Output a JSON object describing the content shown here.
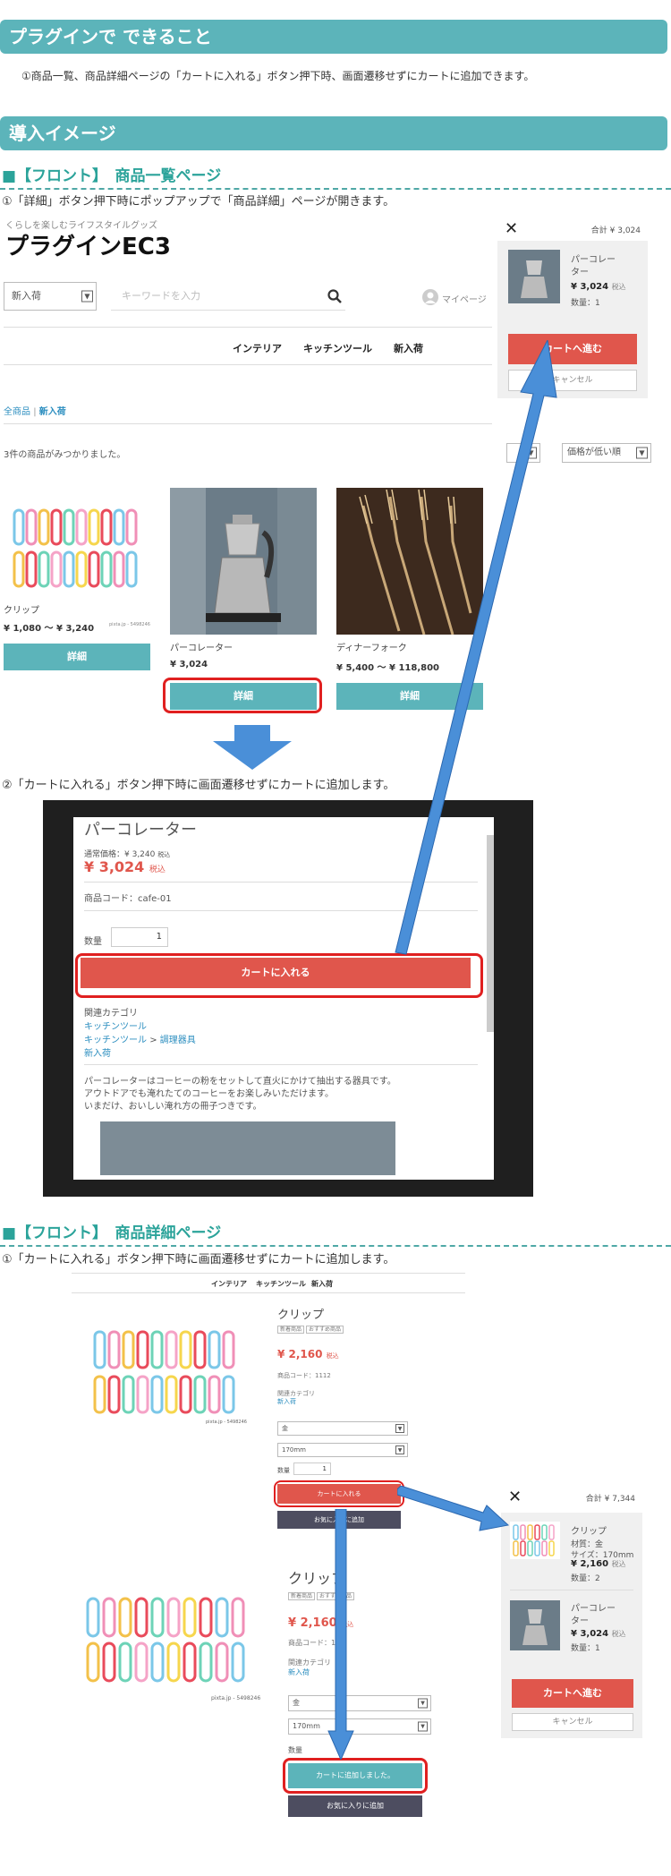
{
  "sections": {
    "can_do_title": "プラグインで できること",
    "can_do_text": "①商品一覧、商品詳細ページの「カートに入れる」ボタン押下時、画面遷移せずにカートに追加できます。",
    "image_title": "導入イメージ",
    "list_title": "■【フロント】　商品一覧ページ",
    "list_step1": "①「詳細」ボタン押下時にポップアップで「商品詳細」ページが開きます。",
    "list_step2": "②「カートに入れる」ボタン押下時に画面遷移せずにカートに追加します。",
    "detail_title": "■【フロント】　商品詳細ページ",
    "detail_step1": "①「カートに入れる」ボタン押下時に画面遷移せずにカートに追加します。"
  },
  "site": {
    "tagline": "くらしを楽しむライフスタイルグッズ",
    "logo": "プラグインEC3",
    "category_select": "新入荷",
    "keyword_placeholder": "キーワードを入力",
    "mypage": "マイページ",
    "nav": [
      "インテリア",
      "キッチンツール",
      "新入荷"
    ],
    "breadcrumb_all": "全商品",
    "breadcrumb_sep": "|",
    "breadcrumb_current": "新入荷",
    "result_count": "3件の商品がみつかりました。",
    "sort_select": "価格が低い順",
    "products": [
      {
        "name": "クリップ",
        "price": "¥ 1,080 〜 ¥ 3,240",
        "button": "詳細",
        "credit": "pixta.jp - 5498246"
      },
      {
        "name": "パーコレーター",
        "price": "¥ 3,024",
        "button": "詳細"
      },
      {
        "name": "ディナーフォーク",
        "price": "¥ 5,400 〜 ¥ 118,800",
        "button": "詳細"
      }
    ]
  },
  "cart1": {
    "close": "✕",
    "total": "合計 ¥ 3,024",
    "item_name_1": "パーコレー",
    "item_name_2": "ター",
    "item_price": "¥ 3,024",
    "tax": "税込",
    "qty": "数量：1",
    "go": "カートへ進む",
    "cancel": "キャンセル"
  },
  "modal": {
    "title": "パーコレーター",
    "regular_price": "通常価格：¥ 3,240",
    "regular_tax": "税込",
    "price": "¥ 3,024",
    "tax": "税込",
    "code_label": "商品コード：",
    "code": "cafe-01",
    "qty_label": "数量",
    "qty": "1",
    "add_button": "カートに入れる",
    "category_label": "関連カテゴリ",
    "cat1": "キッチンツール",
    "cat2a": "キッチンツール",
    "cat2sep": ">",
    "cat2b": "調理器具",
    "cat3": "新入荷",
    "desc1": "パーコレーターはコーヒーの粉をセットして直火にかけて抽出する器具です。",
    "desc2": "アウトドアでも淹れたてのコーヒーをお楽しみいただけます。",
    "desc3": "いまだけ、おいしい淹れ方の冊子つきです。"
  },
  "detail": {
    "nav": [
      "インテリア",
      "キッチンツール",
      "新入荷"
    ],
    "name": "クリップ",
    "tags": [
      "新着商品",
      "おすすめ商品"
    ],
    "price": "¥ 2,160",
    "tax": "税込",
    "code": "商品コード：1112",
    "category_label": "関連カテゴリ",
    "category": "新入荷",
    "credit": "pixta.jp - 5498246",
    "color_select": "金",
    "size_select": "170mm",
    "qty_label": "数量",
    "qty": "1",
    "add_button": "カートに入れる",
    "fav_button": "お気に入りに追加",
    "name2": "クリップ",
    "price2": "¥ 2,160",
    "code2": "商品コード：1",
    "added_button": "カートに追加しました。",
    "fav_button2": "お気に入りに追加"
  },
  "cart2": {
    "close": "✕",
    "total": "合計 ¥ 7,344",
    "item1_name": "クリップ",
    "item1_attr1": "材質：金",
    "item1_attr2": "サイズ：170mm",
    "item1_price": "¥ 2,160",
    "item1_qty": "数量：2",
    "item2_name_1": "パーコレー",
    "item2_name_2": "ター",
    "item2_price": "¥ 3,024",
    "item2_qty": "数量：1",
    "tax": "税込",
    "go": "カートへ進む",
    "cancel": "キャンセル"
  },
  "colors": {
    "teal": "#5cb4ba",
    "red": "#e0564c",
    "arrow": "#4a8fd8",
    "frame": "#e02020"
  }
}
